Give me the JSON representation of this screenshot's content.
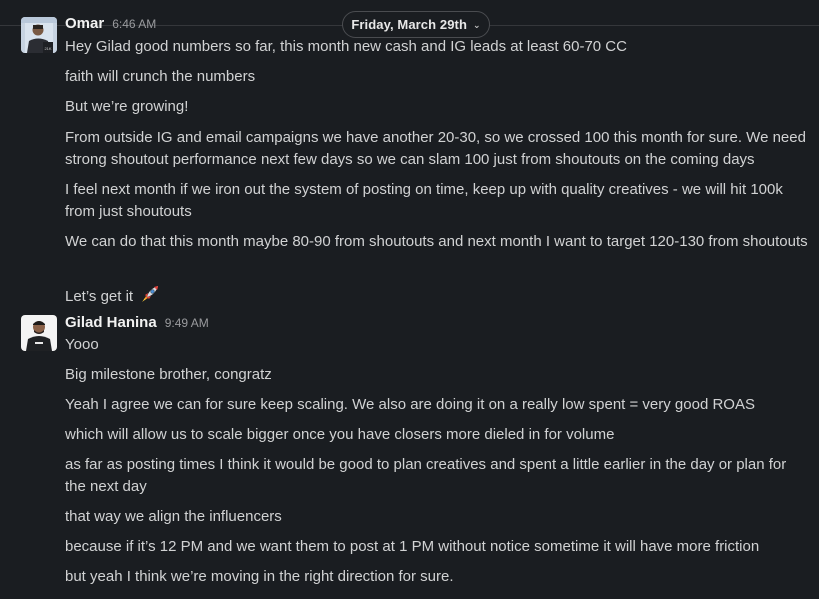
{
  "date_divider": {
    "label": "Friday, March 29th",
    "chevron": "chevron-down-icon"
  },
  "groups": [
    {
      "sender": "Omar",
      "time": "6:46 AM",
      "avatar": "profile-photo",
      "messages": [
        "Hey Gilad good numbers so far, this month new cash and IG leads at least 60-70 CC",
        "faith will crunch the numbers",
        "But we’re growing!",
        "From outside IG and email campaigns we have another 20-30, so we crossed 100 this month for sure. We need strong shoutout performance next few days so we can slam 100 just from shoutouts on the coming days",
        "I feel next month if we iron out the system of posting on time, keep up with quality creatives - we will hit 100k from just shoutouts",
        "We can do that this month maybe 80-90 from shoutouts and next month I want to target 120-130 from shoutouts",
        "Let’s get it"
      ],
      "emoji": "rocket-icon"
    },
    {
      "sender": "Gilad Hanina",
      "time": "9:49 AM",
      "avatar": "profile-photo",
      "messages": [
        "Yooo",
        "Big milestone brother, congratz",
        "Yeah I agree we can for sure keep scaling. We also are doing it on a really low spent = very good ROAS",
        "which will allow us to scale bigger once you have closers more dieled in for volume",
        "as far as posting times I think it would be good to plan creatives and spent a little earlier in the day or plan for the next day",
        "that way we align the influencers",
        "because if it’s 12 PM and we want them to post at 1 PM without notice sometime it will have more friction",
        "but yeah I think we’re moving in the right direction for sure."
      ]
    }
  ]
}
